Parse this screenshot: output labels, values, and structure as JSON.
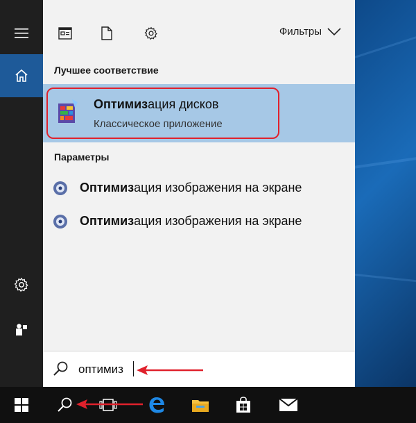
{
  "start_menu": {
    "filters_label": "Фильтры",
    "best_match_title": "Лучшее соответствие",
    "best_match": {
      "title_bold": "Оптимиз",
      "title_rest": "ация дисков",
      "subtitle": "Классическое приложение"
    },
    "settings_title": "Параметры",
    "settings_results": [
      {
        "label_bold": "Оптимиз",
        "label_rest": "ация изображения на экране"
      },
      {
        "label_bold": "Оптимиз",
        "label_rest": "ация изображения на экране"
      }
    ]
  },
  "search": {
    "query": "оптимиз"
  },
  "colors": {
    "rail_bg": "#1f1f1f",
    "rail_active": "#1e5a99",
    "panel_bg": "#f2f2f2",
    "best_match_bg": "#a6c8e6",
    "highlight_outline": "#e0212c",
    "annotation_arrow": "#e0212c",
    "taskbar_bg": "#101010",
    "edge_blue": "#1e88e5"
  },
  "icons": {
    "rail": [
      "hamburger-icon",
      "home-icon",
      "gear-icon",
      "user-icon"
    ],
    "top": [
      "documents-icon",
      "file-icon",
      "gear-icon",
      "chevron-down-icon"
    ],
    "taskbar": [
      "windows-icon",
      "search-icon",
      "task-view-icon",
      "edge-icon",
      "file-explorer-icon",
      "store-icon",
      "mail-icon"
    ]
  }
}
